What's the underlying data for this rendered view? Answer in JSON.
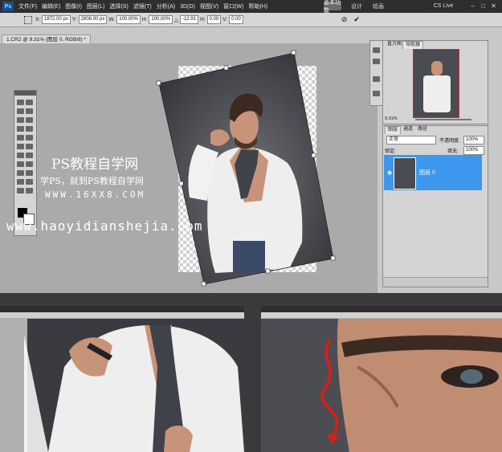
{
  "menu": [
    "文件(F)",
    "编辑(E)",
    "图像(I)",
    "图层(L)",
    "选择(S)",
    "滤镜(T)",
    "分析(A)",
    "3D(D)",
    "视图(V)",
    "窗口(W)",
    "帮助(H)"
  ],
  "workspaces": [
    "基本功能",
    "设计",
    "绘画"
  ],
  "workspace_active": "基本功能",
  "cs_live": "CS Live",
  "options": {
    "x": "1872.00 px",
    "y": "2808.00 px",
    "w": "100.00%",
    "h": "100.00%",
    "angle": "-12.91",
    "h_skew": "0.00",
    "v_skew": "0.00",
    "w_label": "W:",
    "h_label": "H:",
    "x_label": "X:",
    "y_label": "Y:",
    "angle_label": "△",
    "h_skew_label": "H:",
    "v_skew_label": "V:"
  },
  "document_tab": "1.CR2 @ 9.31% (图层 0, RGB/8) *",
  "navigator_tabs": [
    "直方图",
    "导航器"
  ],
  "navigator_zoom": "9.31%",
  "layers_tabs": [
    "图层",
    "通道",
    "路径"
  ],
  "blend_mode": "正常",
  "opacity_label": "不透明度:",
  "opacity": "100%",
  "fill_label": "填充:",
  "fill": "100%",
  "lock_label": "锁定:",
  "layer_name": "图层 0",
  "watermark": {
    "line1": "PS教程自学网",
    "line2": "学PS，就到PS教程自学网",
    "line3": "WWW.16XX8.COM",
    "line4": "www.haoyidianshejia.com"
  },
  "colors": {
    "accent": "#3d97ef",
    "dark": "#2e2e2e",
    "panel": "#d4d4d4",
    "canvas": "#aaaaaa",
    "tie": "#3f4349",
    "shirt": "#f1f1f1",
    "red_arrow": "#d41f1f"
  },
  "icons": [
    "ps-logo",
    "minimize-icon",
    "maximize-icon",
    "close-icon",
    "move-tool-icon",
    "cancel-transform-icon",
    "commit-transform-icon",
    "eye-icon",
    "layer-thumbnail"
  ]
}
